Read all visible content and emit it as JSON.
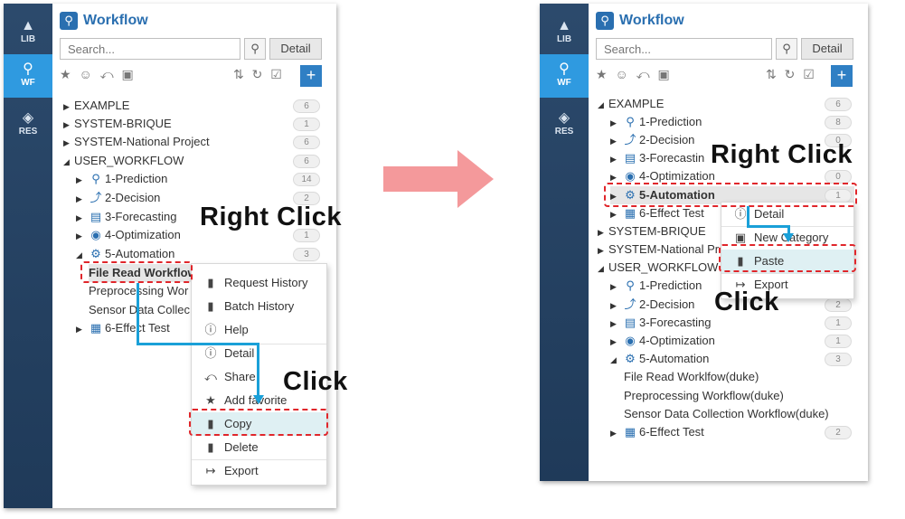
{
  "rail": {
    "lib": "LIB",
    "wf": "WF",
    "res": "RES"
  },
  "app": {
    "title": "Workflow",
    "search_placeholder": "Search...",
    "detail_button": "Detail",
    "add_button": "+"
  },
  "left": {
    "tree": [
      {
        "label": "EXAMPLE",
        "count": "6"
      },
      {
        "label": "SYSTEM-BRIQUE",
        "count": "1"
      },
      {
        "label": "SYSTEM-National Project",
        "count": "6"
      },
      {
        "label": "USER_WORKFLOW",
        "count": "6"
      },
      {
        "label": "1-Prediction",
        "count": "14"
      },
      {
        "label": "2-Decision",
        "count": "2"
      },
      {
        "label": "3-Forecasting",
        "count": ""
      },
      {
        "label": "4-Optimization",
        "count": "1"
      },
      {
        "label": "5-Automation",
        "count": "3"
      },
      {
        "label": "File Read Workflow",
        "count": ""
      },
      {
        "label": "Preprocessing Wor",
        "count": ""
      },
      {
        "label": "Sensor Data Collec",
        "count": ""
      },
      {
        "label": "6-Effect Test",
        "count": ""
      }
    ],
    "menu": [
      "Request History",
      "Batch History",
      "Help",
      "Detail",
      "Share",
      "Add favorite",
      "Copy",
      "Delete",
      "Export"
    ],
    "right_click_label": "Right Click",
    "click_label": "Click"
  },
  "right": {
    "tree": [
      {
        "label": "EXAMPLE",
        "count": "6"
      },
      {
        "label": "1-Prediction",
        "count": "8"
      },
      {
        "label": "2-Decision",
        "count": "0"
      },
      {
        "label": "3-Forecastin",
        "count": ""
      },
      {
        "label": "4-Optimization",
        "count": "0"
      },
      {
        "label": "5-Automation",
        "count": "1"
      },
      {
        "label": "6-Effect Test",
        "count": ""
      },
      {
        "label": "SYSTEM-BRIQUE",
        "count": ""
      },
      {
        "label": "SYSTEM-National Pr",
        "count": ""
      },
      {
        "label": "USER_WORKFLOW",
        "count": ""
      },
      {
        "label": "1-Prediction",
        "count": ""
      },
      {
        "label": "2-Decision",
        "count": "2"
      },
      {
        "label": "3-Forecasting",
        "count": "1"
      },
      {
        "label": "4-Optimization",
        "count": "1"
      },
      {
        "label": "5-Automation",
        "count": "3"
      },
      {
        "label": "File Read Worklfow(duke)",
        "count": ""
      },
      {
        "label": "Preprocessing Workflow(duke)",
        "count": ""
      },
      {
        "label": "Sensor Data Collection Workflow(duke)",
        "count": ""
      },
      {
        "label": "6-Effect Test",
        "count": "2"
      }
    ],
    "menu": [
      "Detail",
      "New Category",
      "Paste",
      "Export"
    ],
    "right_click_label": "Right Click",
    "click_label": "Click"
  },
  "colors": {
    "accent": "#2a6fb0",
    "rail": "#1f3a59",
    "rail_active": "#2f9ae0",
    "highlight": "#e0262b",
    "connector": "#1aa0d8",
    "big_arrow": "#f4999b",
    "menu_hover": "#dff0f3"
  },
  "icons": {
    "lib": "shapes-icon",
    "wf": "workflow-icon",
    "res": "layers-icon",
    "search": "search-icon",
    "favorite": "star-icon",
    "user": "user-icon",
    "share": "share-icon",
    "folder": "folder-icon",
    "sort": "sort-az-icon",
    "refresh": "refresh-icon",
    "check": "checklist-icon"
  }
}
